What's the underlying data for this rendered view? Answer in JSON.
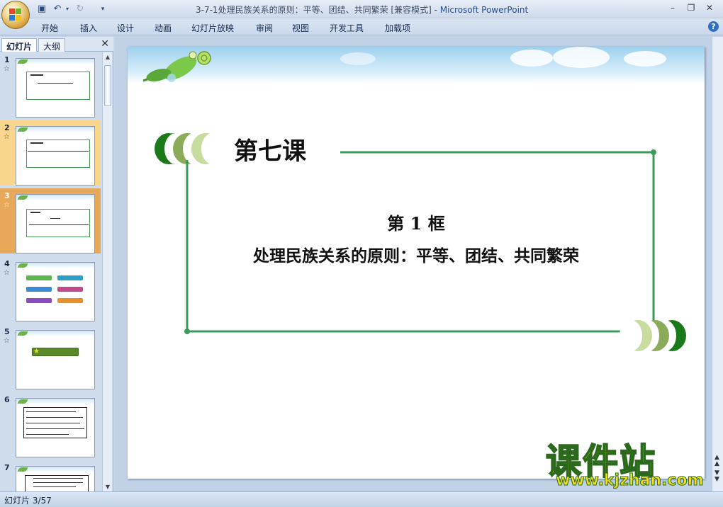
{
  "window": {
    "title_doc": "3-7-1处理民族关系的原则：平等、团结、共同繁荣 [兼容模式] - ",
    "title_app": "Microsoft PowerPoint"
  },
  "quick_access": {
    "save_icon": "save-icon",
    "undo_icon": "undo-icon",
    "redo_icon": "redo-icon"
  },
  "ribbon": {
    "tabs": [
      "开始",
      "插入",
      "设计",
      "动画",
      "幻灯片放映",
      "审阅",
      "视图",
      "开发工具",
      "加载项"
    ],
    "help": "?"
  },
  "left_pane": {
    "tabs": [
      "幻灯片",
      "大纲"
    ],
    "close": "✕",
    "slides": [
      {
        "num": "1",
        "star": "☆"
      },
      {
        "num": "2",
        "star": "☆"
      },
      {
        "num": "3",
        "star": "☆"
      },
      {
        "num": "4",
        "star": "☆"
      },
      {
        "num": "5",
        "star": "☆"
      },
      {
        "num": "6",
        "star": ""
      },
      {
        "num": "7",
        "star": ""
      }
    ]
  },
  "slide": {
    "lesson": "第七课",
    "frame_number": "第 1 框",
    "frame_title": "处理民族关系的原则：平等、团结、共同繁荣",
    "colors": {
      "dark_green": "#1a7a1a",
      "olive": "#8cab5a",
      "light_green": "#c8dca0",
      "line": "#3a9a5a"
    }
  },
  "status": {
    "text": "幻灯片 3/57"
  },
  "watermark": {
    "big": "课件站",
    "small": "www.kjzhan.com"
  }
}
